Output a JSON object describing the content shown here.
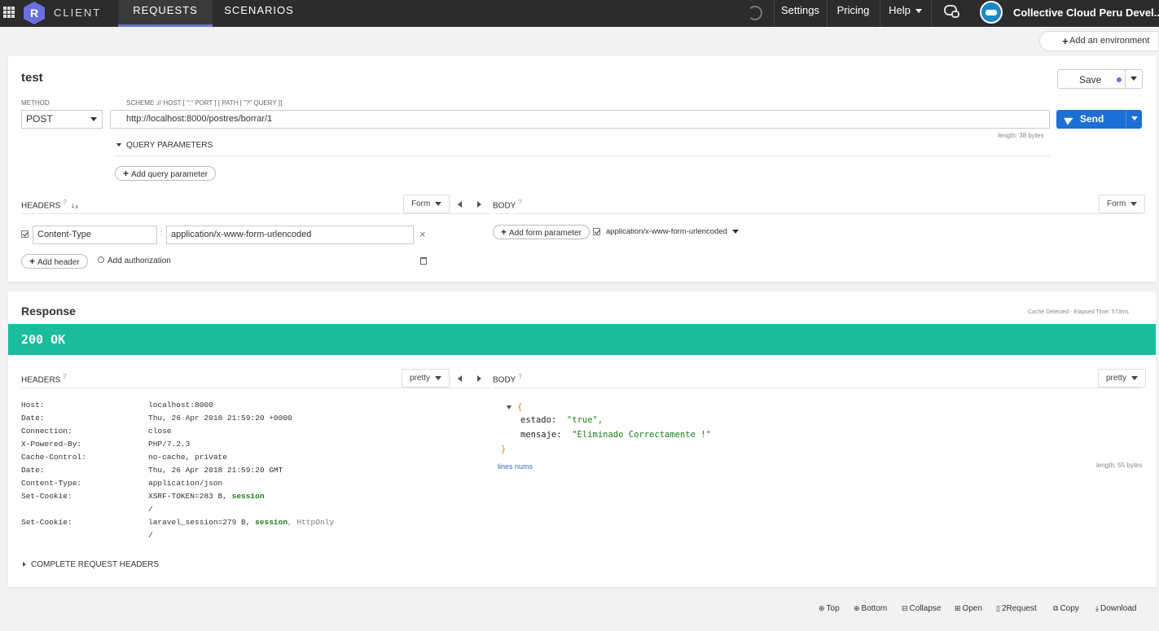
{
  "topbar": {
    "logo_letter": "R",
    "brand": "CLIENT",
    "tabs": [
      {
        "label": "REQUESTS"
      },
      {
        "label": "SCENARIOS"
      }
    ],
    "settings": "Settings",
    "pricing": "Pricing",
    "help": "Help",
    "account": "Collective Cloud Peru Devel...",
    "accent_color": "#6b6fe0"
  },
  "environment_button": "Add an environment",
  "request": {
    "name": "test",
    "save_label": "Save",
    "method_label": "METHOD",
    "method_value": "POST",
    "url_hint": "SCHEME :// HOST [ \":\" PORT ] [ PATH [ \"?\" QUERY ]]",
    "url_value": "http://localhost:8000/postres/borrar/1",
    "url_length": "length: 38 bytes",
    "send_label": "Send",
    "query_params_label": "QUERY PARAMETERS",
    "add_query_param": "Add query parameter",
    "headers_label": "HEADERS",
    "headers_form_dd": "Form",
    "header_rows": [
      {
        "name": "Content-Type",
        "value": "application/x-www-form-urlencoded"
      }
    ],
    "add_header": "Add header",
    "add_authorization": "Add authorization",
    "body_label": "BODY",
    "body_form_dd": "Form",
    "add_form_param": "Add form parameter",
    "body_content_type": "application/x-www-form-urlencoded"
  },
  "response": {
    "title": "Response",
    "cache_info": "Cache Detected - Elapsed Time: 573ms",
    "status": "200 OK",
    "status_color": "#1abc9c",
    "headers_label": "HEADERS",
    "headers_dd": "pretty",
    "body_label": "BODY",
    "body_dd": "pretty",
    "headers": [
      {
        "name": "Host:",
        "value": "localhost:8000"
      },
      {
        "name": "Date:",
        "value": "Thu, 26 Apr 2018 21:59:20 +0000"
      },
      {
        "name": "Connection:",
        "value": "close"
      },
      {
        "name": "X-Powered-By:",
        "value": "PHP/7.2.3"
      },
      {
        "name": "Cache-Control:",
        "value": "no-cache, private"
      },
      {
        "name": "Date:",
        "value": "Thu, 26 Apr 2018 21:59:20 GMT"
      },
      {
        "name": "Content-Type:",
        "value": "application/json"
      }
    ],
    "cookies": [
      {
        "name": "Set-Cookie:",
        "value": "XSRF-TOKEN=283 B,",
        "flag": "session",
        "extra": "",
        "path": "/"
      },
      {
        "name": "Set-Cookie:",
        "value": "laravel_session=279 B,",
        "flag": "session",
        "extra": ", HttpOnly",
        "path": "/"
      }
    ],
    "complete_request_headers": "COMPLETE REQUEST HEADERS",
    "body_json": {
      "open": "{",
      "close": "}",
      "rows": [
        {
          "key": "estado:",
          "value": "\"true\","
        },
        {
          "key": "mensaje:",
          "value": "\"Eliminado Correctamente !\""
        }
      ]
    },
    "lines_nums": "lines nums",
    "body_length": "length: 55 bytes"
  },
  "footer": [
    "Top",
    "Bottom",
    "Collapse",
    "Open",
    "2Request",
    "Copy",
    "Download"
  ]
}
